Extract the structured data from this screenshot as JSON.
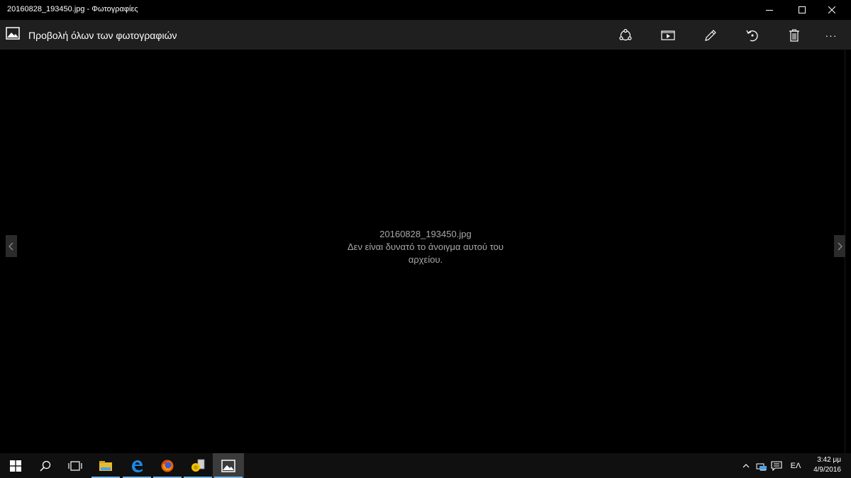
{
  "window": {
    "title": "20160828_193450.jpg - Φωτογραφίες",
    "controls": [
      "minimize",
      "maximize",
      "close"
    ]
  },
  "appbar": {
    "back_label": "Προβολή όλων των φωτογραφιών",
    "back_icon": "photo-icon",
    "tools": [
      {
        "name": "share-icon"
      },
      {
        "name": "slideshow-icon"
      },
      {
        "name": "edit-icon"
      },
      {
        "name": "rotate-icon"
      },
      {
        "name": "delete-icon"
      },
      {
        "name": "more-icon",
        "label": "···"
      }
    ]
  },
  "content": {
    "filename": "20160828_193450.jpg",
    "error_line1": "Δεν είναι δυνατό το άνοιγμα αυτού του",
    "error_line2": "αρχείου."
  },
  "taskbar": {
    "items": [
      "start-icon",
      "search-icon",
      "task-view-icon",
      "file-explorer-icon",
      "edge-icon",
      "firefox-icon",
      "app-icon",
      "photos-icon"
    ],
    "tray": {
      "language": "ΕΛ",
      "time": "3:42 μμ",
      "date": "4/9/2016"
    }
  },
  "colors": {
    "background": "#000000",
    "appbar": "#1f1f1f",
    "taskbar": "#101010",
    "accent": "#76b9ed",
    "message_text": "#a8a8a8"
  }
}
